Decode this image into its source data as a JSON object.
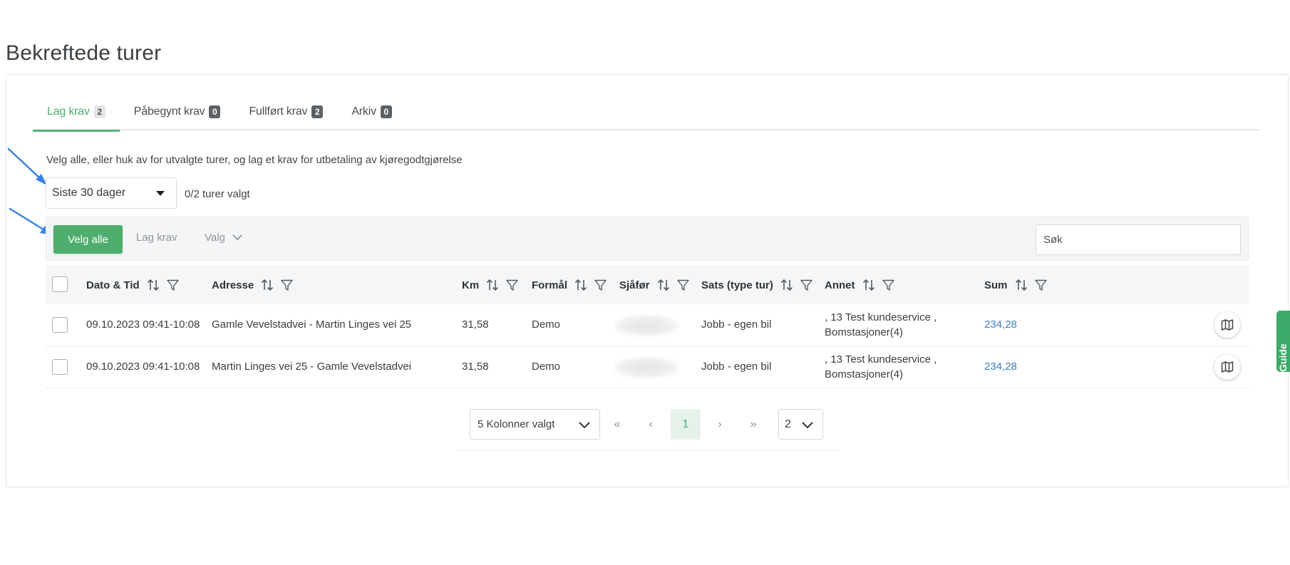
{
  "page_title": "Bekreftede turer",
  "tabs": [
    {
      "label": "Lag krav",
      "count": "2",
      "active": true
    },
    {
      "label": "Påbegynt krav",
      "count": "0",
      "active": false
    },
    {
      "label": "Fullført krav",
      "count": "2",
      "active": false
    },
    {
      "label": "Arkiv",
      "count": "0",
      "active": false
    }
  ],
  "instruction": "Velg alle, eller huk av for utvalgte turer, og lag et krav for utbetaling av kjøregodtgjørelse",
  "period_filter": {
    "value": "Siste 30 dager"
  },
  "selection_status": "0/2 turer valgt",
  "toolbar": {
    "select_all": "Velg alle",
    "create_claim": "Lag krav",
    "options": "Valg",
    "search_placeholder": "Søk"
  },
  "table": {
    "columns": [
      "Dato & Tid",
      "Adresse",
      "Km",
      "Formål",
      "Sjåfør",
      "Sats (type tur)",
      "Annet",
      "Sum"
    ],
    "rows": [
      {
        "date_time": "09.10.2023 09:41-10:08",
        "address": "Gamle Vevelstadvei - Martin Linges vei 25",
        "km": "31,58",
        "purpose": "Demo",
        "rate": "Jobb - egen bil",
        "other_line1": ", 13 Test kundeservice ,",
        "other_line2": "Bomstasjoner(4)",
        "sum": "234,28"
      },
      {
        "date_time": "09.10.2023 09:41-10:08",
        "address": "Martin Linges vei 25 - Gamle Vevelstadvei",
        "km": "31,58",
        "purpose": "Demo",
        "rate": "Jobb - egen bil",
        "other_line1": ", 13 Test kundeservice ,",
        "other_line2": "Bomstasjoner(4)",
        "sum": "234,28"
      }
    ]
  },
  "pagination": {
    "columns_select": "5 Kolonner valgt",
    "first": "«",
    "prev": "‹",
    "current_page": "1",
    "next": "›",
    "last": "»",
    "page_size": "2"
  },
  "guide_tab": "Guide",
  "colors": {
    "accent": "#4fae6d",
    "link": "#3e7ec1",
    "annotation_arrow": "#3b82e6"
  },
  "icons": [
    "sort-icon",
    "filter-icon",
    "map-icon",
    "chevron-down-icon",
    "caret-down-icon",
    "annotation-arrow-icon"
  ]
}
